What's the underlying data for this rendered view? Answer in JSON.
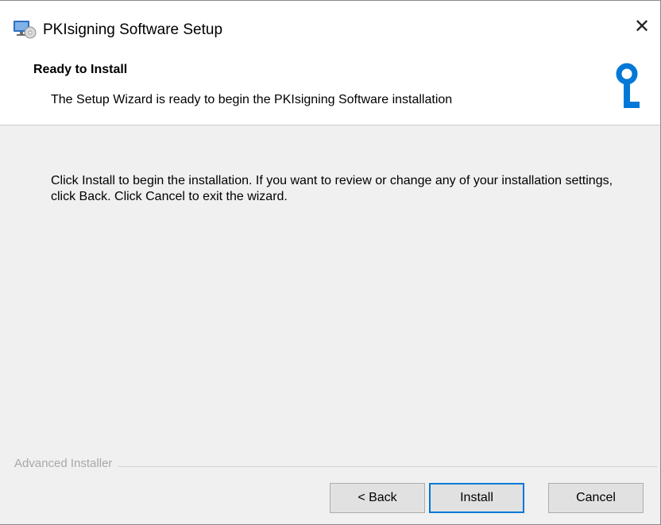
{
  "window": {
    "title": "PKIsigning Software Setup",
    "app_icon": "installer-computer-icon",
    "close_icon": "close-icon",
    "close_glyph": "✕"
  },
  "header": {
    "title": "Ready to Install",
    "description": "The Setup Wizard is ready to begin the PKIsigning Software installation",
    "logo_icon": "key-logo-icon",
    "logo_color": "#0078d7"
  },
  "body": {
    "message": "Click Install to begin the installation.  If you want to review or change any of your installation settings, click Back.  Click Cancel to exit the wizard."
  },
  "footer": {
    "brand": "Advanced Installer",
    "buttons": {
      "back": "< Back",
      "install": "Install",
      "cancel": "Cancel"
    }
  }
}
